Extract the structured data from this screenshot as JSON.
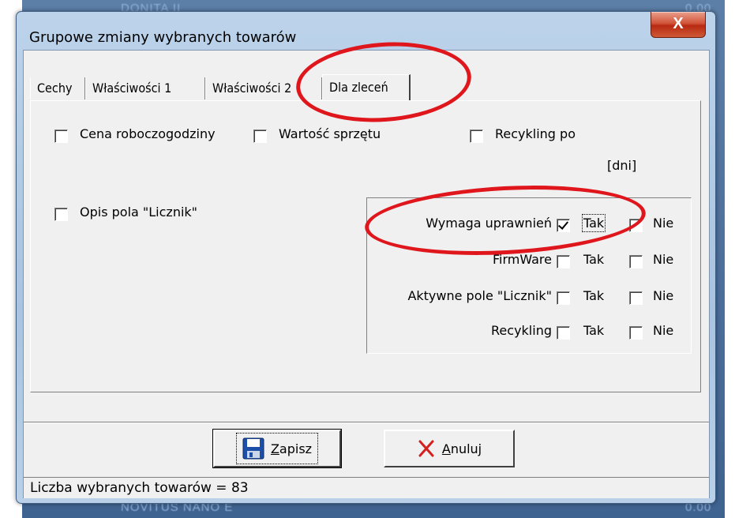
{
  "background": {
    "text_top_left": "DONITA II",
    "text_top_right": "0.00",
    "text_bottom_left": "NOVITUS NANO E",
    "text_bottom_right": "0.00"
  },
  "window": {
    "title": "Grupowe zmiany wybranych towarów",
    "close_label": "X"
  },
  "tabs": [
    {
      "label": "Cechy"
    },
    {
      "label": "Właściwości 1"
    },
    {
      "label": "Właściwości 2"
    },
    {
      "label": "Dla zleceń",
      "active": true
    }
  ],
  "panel": {
    "cena_roboczogodziny": {
      "label": "Cena roboczogodziny",
      "checked": false
    },
    "wartosc_sprzetu": {
      "label": "Wartość sprzętu",
      "checked": false
    },
    "recykling_po": {
      "label": "Recykling po",
      "checked": false,
      "unit": "[dni]"
    },
    "opis_pola_licznik": {
      "label": "Opis pola \"Licznik\"",
      "checked": false
    },
    "options": [
      {
        "label": "Wymaga uprawnień",
        "tak": true,
        "nie": false
      },
      {
        "label": "FirmWare",
        "tak": false,
        "nie": false
      },
      {
        "label": "Aktywne pole \"Licznik\"",
        "tak": false,
        "nie": false
      },
      {
        "label": "Recykling",
        "tak": false,
        "nie": false
      }
    ],
    "tak_label": "Tak",
    "nie_label": "Nie"
  },
  "buttons": {
    "save_prefix": "",
    "save_hotkey": "Z",
    "save_rest": "apisz",
    "cancel_hotkey": "A",
    "cancel_rest": "nuluj"
  },
  "status": {
    "text": "Liczba wybranych towarów = 83"
  },
  "colors": {
    "annotation": "#e0161d",
    "save_icon": "#1d4fa8",
    "cancel_icon": "#d42020"
  }
}
